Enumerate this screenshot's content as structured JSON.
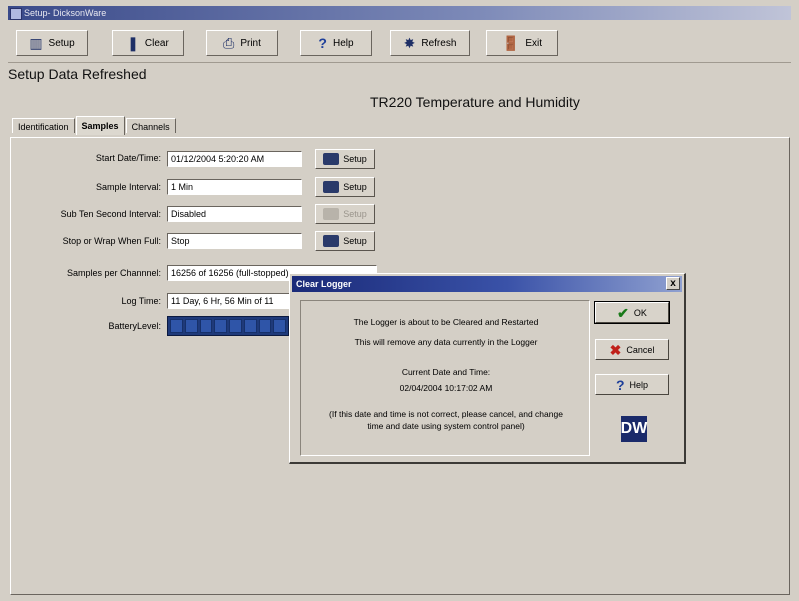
{
  "window": {
    "title": "Setup- DicksonWare"
  },
  "toolbar": {
    "buttons": [
      {
        "label": "Setup",
        "icon": "setup-icon"
      },
      {
        "label": "Clear",
        "icon": "clear-icon"
      },
      {
        "label": "Print",
        "icon": "print-icon"
      },
      {
        "label": "Help",
        "icon": "help-icon"
      },
      {
        "label": "Refresh",
        "icon": "refresh-icon"
      },
      {
        "label": "Exit",
        "icon": "exit-icon"
      }
    ]
  },
  "status": "Setup Data Refreshed",
  "device_title": "TR220 Temperature and Humidity",
  "tabs": [
    {
      "label": "Identification",
      "active": false
    },
    {
      "label": "Samples",
      "active": true
    },
    {
      "label": "Channels",
      "active": false
    }
  ],
  "fields": {
    "start": {
      "label": "Start Date/Time:",
      "value": "01/12/2004 5:20:20 AM",
      "button": "Setup"
    },
    "interval": {
      "label": "Sample Interval:",
      "value": "1 Min",
      "button": "Setup"
    },
    "subten": {
      "label": "Sub Ten Second Interval:",
      "value": "Disabled",
      "button": "Setup"
    },
    "stopwrap": {
      "label": "Stop or Wrap When Full:",
      "value": "Stop",
      "button": "Setup"
    },
    "samples": {
      "label": "Samples per Channnel:",
      "value": "16256 of 16256 (full-stopped)"
    },
    "logtime": {
      "label": "Log Time:",
      "value": "11 Day, 6 Hr, 56 Min of 11"
    },
    "battery": {
      "label": "BatteryLevel:",
      "level": 1.0
    }
  },
  "dialog": {
    "title": "Clear Logger",
    "close": "x",
    "line1": "The Logger is about to be Cleared and Restarted",
    "line2": "This will remove any data currently in the Logger",
    "line3": "Current Date and Time:",
    "datetime": "02/04/2004 10:17:02 AM",
    "note1": "(If this date and time is not correct, please cancel, and change",
    "note2": "time and date using system control panel)",
    "ok": "OK",
    "cancel": "Cancel",
    "help": "Help",
    "logo_text": "DW"
  },
  "colors": {
    "background": "#d4cfc6",
    "titlebar": "#1a2a78",
    "battery": "#1f3a7a"
  }
}
